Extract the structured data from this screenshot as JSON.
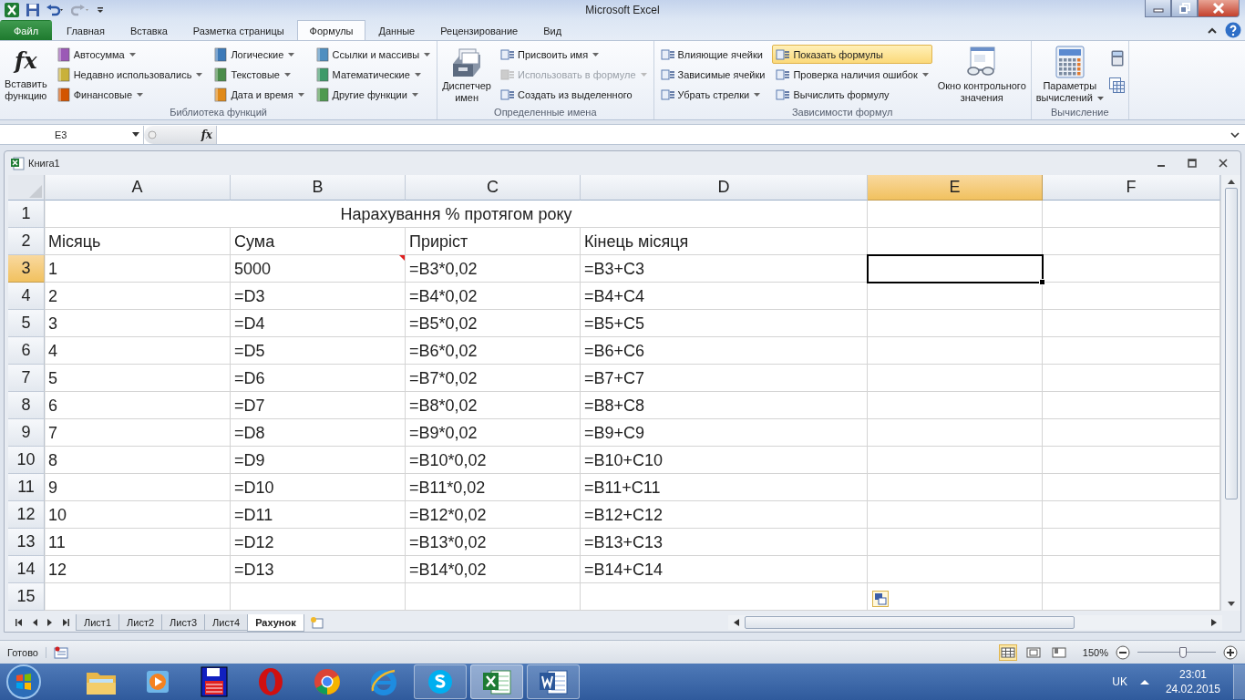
{
  "window": {
    "title": "Microsoft Excel"
  },
  "ribbon_tabs": [
    {
      "label": "Файл",
      "kind": "file",
      "selected": false
    },
    {
      "label": "Главная",
      "kind": "tab",
      "selected": false
    },
    {
      "label": "Вставка",
      "kind": "tab",
      "selected": false
    },
    {
      "label": "Разметка страницы",
      "kind": "tab",
      "selected": false
    },
    {
      "label": "Формулы",
      "kind": "tab",
      "selected": true
    },
    {
      "label": "Данные",
      "kind": "tab",
      "selected": false
    },
    {
      "label": "Рецензирование",
      "kind": "tab",
      "selected": false
    },
    {
      "label": "Вид",
      "kind": "tab",
      "selected": false
    }
  ],
  "ribbon_groups": [
    {
      "label": "Библиотека функций",
      "parts": [
        {
          "kind": "large",
          "glyph": "fx",
          "lines": [
            "Вставить",
            "функцию"
          ],
          "dropdown": false
        },
        {
          "kind": "column",
          "items": [
            {
              "label": "Автосумма",
              "dropdown": true,
              "disabled": false,
              "on": false
            },
            {
              "label": "Недавно использовались",
              "dropdown": true,
              "disabled": false,
              "on": false
            },
            {
              "label": "Финансовые",
              "dropdown": true,
              "disabled": false,
              "on": false
            }
          ]
        },
        {
          "kind": "column",
          "items": [
            {
              "label": "Логические",
              "dropdown": true,
              "disabled": false,
              "on": false
            },
            {
              "label": "Текстовые",
              "dropdown": true,
              "disabled": false,
              "on": false
            },
            {
              "label": "Дата и время",
              "dropdown": true,
              "disabled": false,
              "on": false
            }
          ]
        },
        {
          "kind": "column",
          "items": [
            {
              "label": "Ссылки и массивы",
              "dropdown": true,
              "disabled": false,
              "on": false
            },
            {
              "label": "Математические",
              "dropdown": true,
              "disabled": false,
              "on": false
            },
            {
              "label": "Другие функции",
              "dropdown": true,
              "disabled": false,
              "on": false
            }
          ]
        }
      ]
    },
    {
      "label": "Определенные имена",
      "parts": [
        {
          "kind": "large",
          "lines": [
            "Диспетчер",
            "имен"
          ],
          "dropdown": false
        },
        {
          "kind": "column",
          "items": [
            {
              "label": "Присвоить имя",
              "dropdown": true,
              "disabled": false,
              "on": false
            },
            {
              "label": "Использовать в формуле",
              "dropdown": true,
              "disabled": true,
              "on": false
            },
            {
              "label": "Создать из выделенного",
              "dropdown": false,
              "disabled": false,
              "on": false
            }
          ]
        }
      ]
    },
    {
      "label": "Зависимости формул",
      "parts": [
        {
          "kind": "column",
          "items": [
            {
              "label": "Влияющие ячейки",
              "dropdown": false,
              "disabled": false,
              "on": false
            },
            {
              "label": "Зависимые ячейки",
              "dropdown": false,
              "disabled": false,
              "on": false
            },
            {
              "label": "Убрать стрелки",
              "dropdown": true,
              "disabled": false,
              "on": false
            }
          ]
        },
        {
          "kind": "column",
          "items": [
            {
              "label": "Показать формулы",
              "dropdown": false,
              "disabled": false,
              "on": true
            },
            {
              "label": "Проверка наличия ошибок",
              "dropdown": true,
              "disabled": false,
              "on": false
            },
            {
              "label": "Вычислить формулу",
              "dropdown": false,
              "disabled": false,
              "on": false
            }
          ]
        },
        {
          "kind": "large",
          "lines": [
            "Окно контрольного",
            "значения"
          ],
          "dropdown": false
        }
      ]
    },
    {
      "label": "Вычисление",
      "parts": [
        {
          "kind": "large",
          "lines": [
            "Параметры",
            "вычислений"
          ],
          "dropdown": true
        },
        {
          "kind": "icon_column"
        }
      ]
    }
  ],
  "formula_bar": {
    "name_box": "E3",
    "fx": "fx"
  },
  "workbook": {
    "title": "Книга1",
    "columns": [
      {
        "label": "A",
        "selected": false
      },
      {
        "label": "B",
        "selected": false
      },
      {
        "label": "C",
        "selected": false
      },
      {
        "label": "D",
        "selected": false
      },
      {
        "label": "E",
        "selected": true
      },
      {
        "label": "F",
        "selected": false
      }
    ],
    "rows": [
      {
        "number": "1",
        "selected": false,
        "title": "Нарахування % протягом року"
      },
      {
        "number": "2",
        "selected": false,
        "cells": [
          {
            "text": "Місяць",
            "comment": false
          },
          {
            "text": "Сума",
            "comment": false
          },
          {
            "text": "Приріст",
            "comment": false
          },
          {
            "text": "Кінець місяця",
            "comment": false
          }
        ]
      },
      {
        "number": "3",
        "selected": true,
        "cells": [
          {
            "text": "1",
            "comment": false
          },
          {
            "text": "5000",
            "comment": true
          },
          {
            "text": "=B3*0,02",
            "comment": false
          },
          {
            "text": "=B3+C3",
            "comment": false
          }
        ]
      },
      {
        "number": "4",
        "selected": false,
        "cells": [
          {
            "text": "2",
            "comment": false
          },
          {
            "text": "=D3",
            "comment": false
          },
          {
            "text": "=B4*0,02",
            "comment": false
          },
          {
            "text": "=B4+C4",
            "comment": false
          }
        ]
      },
      {
        "number": "5",
        "selected": false,
        "cells": [
          {
            "text": "3",
            "comment": false
          },
          {
            "text": "=D4",
            "comment": false
          },
          {
            "text": "=B5*0,02",
            "comment": false
          },
          {
            "text": "=B5+C5",
            "comment": false
          }
        ]
      },
      {
        "number": "6",
        "selected": false,
        "cells": [
          {
            "text": "4",
            "comment": false
          },
          {
            "text": "=D5",
            "comment": false
          },
          {
            "text": "=B6*0,02",
            "comment": false
          },
          {
            "text": "=B6+C6",
            "comment": false
          }
        ]
      },
      {
        "number": "7",
        "selected": false,
        "cells": [
          {
            "text": "5",
            "comment": false
          },
          {
            "text": "=D6",
            "comment": false
          },
          {
            "text": "=B7*0,02",
            "comment": false
          },
          {
            "text": "=B7+C7",
            "comment": false
          }
        ]
      },
      {
        "number": "8",
        "selected": false,
        "cells": [
          {
            "text": "6",
            "comment": false
          },
          {
            "text": "=D7",
            "comment": false
          },
          {
            "text": "=B8*0,02",
            "comment": false
          },
          {
            "text": "=B8+C8",
            "comment": false
          }
        ]
      },
      {
        "number": "9",
        "selected": false,
        "cells": [
          {
            "text": "7",
            "comment": false
          },
          {
            "text": "=D8",
            "comment": false
          },
          {
            "text": "=B9*0,02",
            "comment": false
          },
          {
            "text": "=B9+C9",
            "comment": false
          }
        ]
      },
      {
        "number": "10",
        "selected": false,
        "cells": [
          {
            "text": "8",
            "comment": false
          },
          {
            "text": "=D9",
            "comment": false
          },
          {
            "text": "=B10*0,02",
            "comment": false
          },
          {
            "text": "=B10+C10",
            "comment": false
          }
        ]
      },
      {
        "number": "11",
        "selected": false,
        "cells": [
          {
            "text": "9",
            "comment": false
          },
          {
            "text": "=D10",
            "comment": false
          },
          {
            "text": "=B11*0,02",
            "comment": false
          },
          {
            "text": "=B11+C11",
            "comment": false
          }
        ]
      },
      {
        "number": "12",
        "selected": false,
        "cells": [
          {
            "text": "10",
            "comment": false
          },
          {
            "text": "=D11",
            "comment": false
          },
          {
            "text": "=B12*0,02",
            "comment": false
          },
          {
            "text": "=B12+C12",
            "comment": false
          }
        ]
      },
      {
        "number": "13",
        "selected": false,
        "cells": [
          {
            "text": "11",
            "comment": false
          },
          {
            "text": "=D12",
            "comment": false
          },
          {
            "text": "=B13*0,02",
            "comment": false
          },
          {
            "text": "=B13+C13",
            "comment": false
          }
        ]
      },
      {
        "number": "14",
        "selected": false,
        "cells": [
          {
            "text": "12",
            "comment": false
          },
          {
            "text": "=D13",
            "comment": false
          },
          {
            "text": "=B14*0,02",
            "comment": false
          },
          {
            "text": "=B14+C14",
            "comment": false
          }
        ]
      },
      {
        "number": "15",
        "selected": false
      }
    ],
    "sheet_tabs": [
      {
        "label": "Лист1",
        "selected": false
      },
      {
        "label": "Лист2",
        "selected": false
      },
      {
        "label": "Лист3",
        "selected": false
      },
      {
        "label": "Лист4",
        "selected": false
      },
      {
        "label": "Рахунок",
        "selected": true
      }
    ]
  },
  "status_bar": {
    "status": "Готово",
    "views": [
      {
        "selected": true
      },
      {
        "selected": false
      },
      {
        "selected": false
      }
    ],
    "zoom": "150%",
    "zoom_slider": {
      "level": 0.58
    }
  },
  "taskbar": {
    "apps": [
      {
        "kind": "folder",
        "running": false,
        "selected": false
      },
      {
        "kind": "media",
        "running": false,
        "selected": false
      },
      {
        "kind": "floppy",
        "running": false,
        "selected": false
      },
      {
        "kind": "opera",
        "running": false,
        "selected": false
      },
      {
        "kind": "chrome",
        "running": false,
        "selected": false
      },
      {
        "kind": "ie",
        "running": false,
        "selected": false
      },
      {
        "kind": "skype",
        "running": true,
        "selected": false
      },
      {
        "kind": "excel",
        "running": true,
        "selected": true
      },
      {
        "kind": "word",
        "running": true,
        "selected": false
      }
    ],
    "language": "UK",
    "time": "23:01",
    "date": "24.02.2015"
  }
}
